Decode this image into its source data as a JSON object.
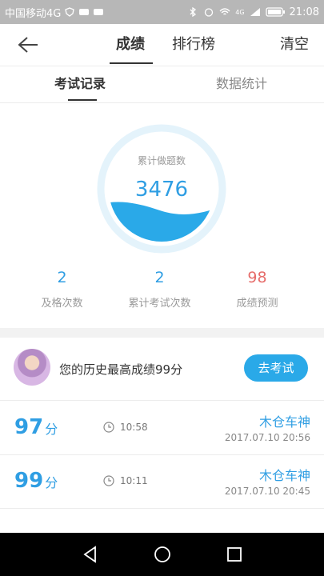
{
  "status_bar": {
    "carrier": "中国移动4G",
    "time": "21:08",
    "network": "4G"
  },
  "nav": {
    "tabs": [
      "成绩",
      "排行榜"
    ],
    "right_action": "清空"
  },
  "subtabs": [
    "考试记录",
    "数据统计"
  ],
  "summary": {
    "ring_label": "累计做题数",
    "total": "3476",
    "stats": [
      {
        "value": "2",
        "label": "及格次数"
      },
      {
        "value": "2",
        "label": "累计考试次数"
      },
      {
        "value": "98",
        "label": "成绩预测"
      }
    ]
  },
  "best": {
    "text": "您的历史最高成绩99分",
    "button": "去考试"
  },
  "records": [
    {
      "score": "97",
      "unit": "分",
      "duration": "10:58",
      "title": "木仓车神",
      "date": "2017.07.10  20:56"
    },
    {
      "score": "99",
      "unit": "分",
      "duration": "10:11",
      "title": "木仓车神",
      "date": "2017.07.10  20:45"
    }
  ],
  "colors": {
    "accent": "#2aa9e8",
    "predict_red": "#e66d6b",
    "statusbar": "#b7b7b7"
  }
}
